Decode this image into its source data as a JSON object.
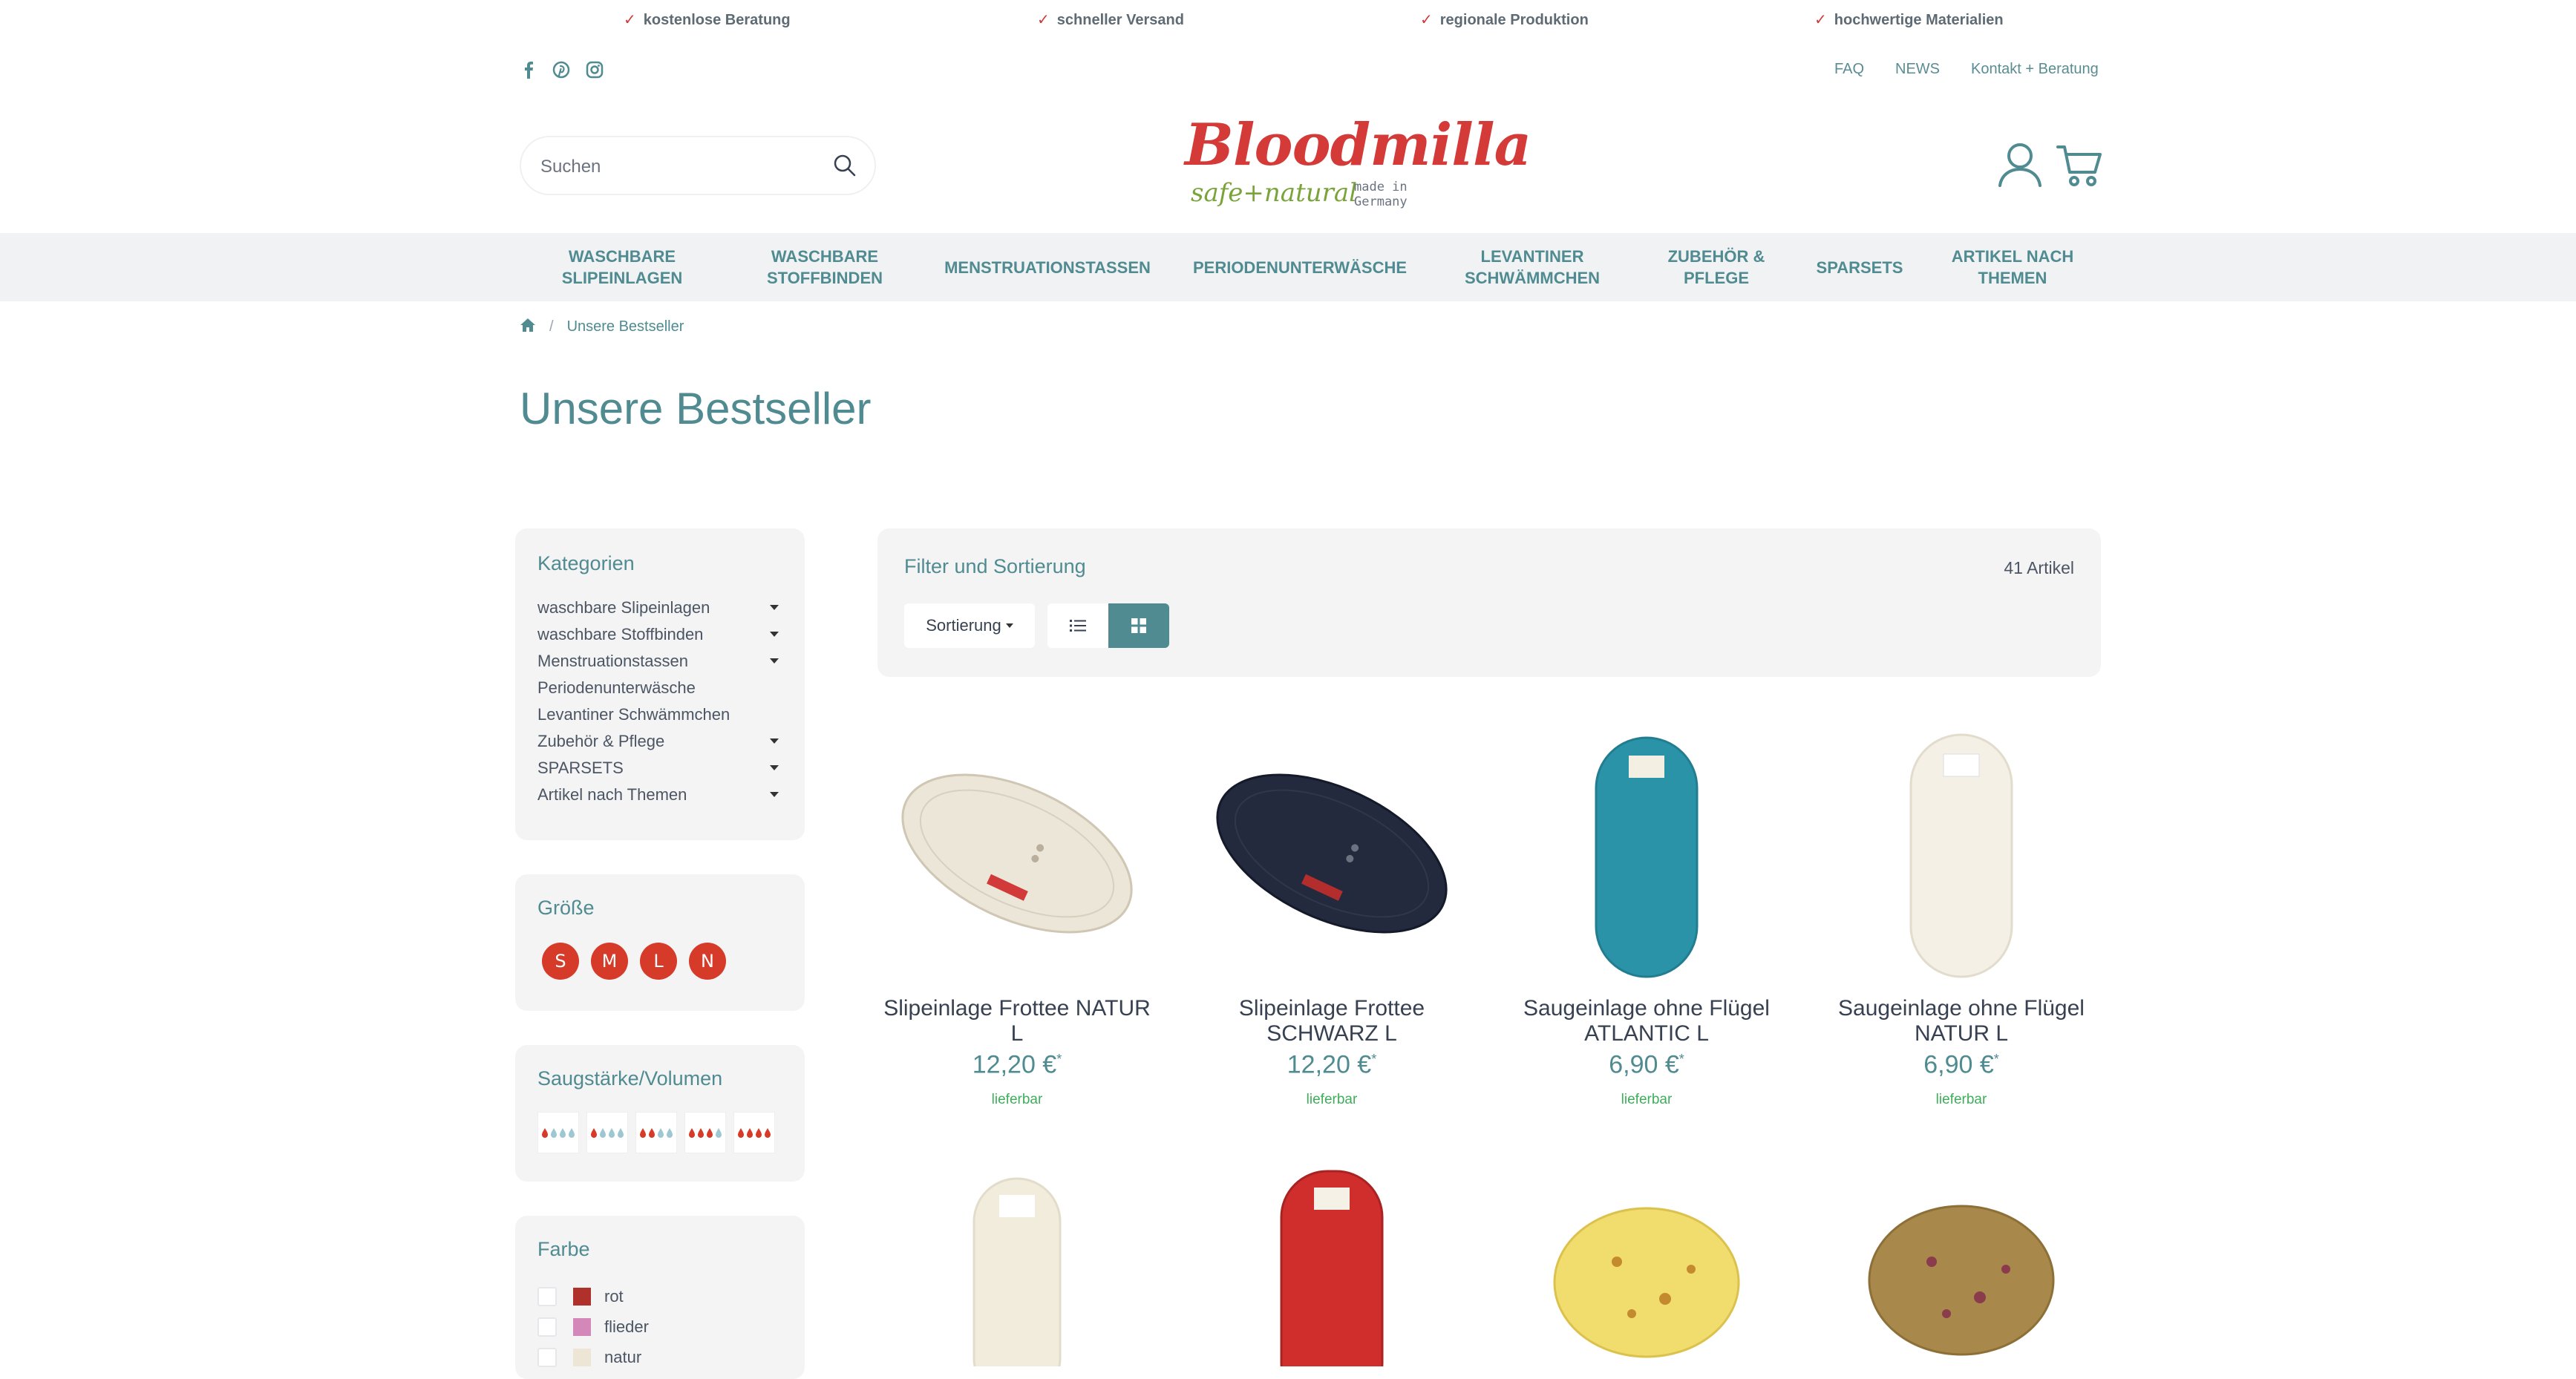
{
  "usp": [
    {
      "check": "✓",
      "text": "kostenlose Beratung"
    },
    {
      "check": "✓",
      "text": "schneller Versand"
    },
    {
      "check": "✓",
      "text": "regionale Produktion"
    },
    {
      "check": "✓",
      "text": "hochwertige Materialien"
    }
  ],
  "top_links": [
    "FAQ",
    "NEWS",
    "Kontakt + Beratung"
  ],
  "search": {
    "placeholder": "Suchen"
  },
  "logo": {
    "word": "Bloodmilla",
    "tagline": "safe+natural",
    "note_line1": "made in",
    "note_line2": "Germany"
  },
  "nav": [
    {
      "line1": "WASCHBARE",
      "line2": "SLIPEINLAGEN"
    },
    {
      "line1": "WASCHBARE",
      "line2": "STOFFBINDEN"
    },
    {
      "line1": "MENSTRUATIONSTASSEN",
      "line2": ""
    },
    {
      "line1": "PERIODENUNTERWÄSCHE",
      "line2": ""
    },
    {
      "line1": "LEVANTINER",
      "line2": "SCHWÄMMCHEN"
    },
    {
      "line1": "ZUBEHÖR &",
      "line2": "PFLEGE"
    },
    {
      "line1": "SPARSETS",
      "line2": ""
    },
    {
      "line1": "ARTIKEL NACH",
      "line2": "THEMEN"
    }
  ],
  "breadcrumb": {
    "separator": "/",
    "current": "Unsere Bestseller"
  },
  "page_title": "Unsere Bestseller",
  "sidebar": {
    "categories_title": "Kategorien",
    "categories": [
      "waschbare Slipeinlagen",
      "waschbare Stoffbinden",
      "Menstruationstassen",
      "Periodenunterwäsche",
      "Levantiner Schwämmchen",
      "Zubehör & Pflege",
      "SPARSETS",
      "Artikel nach Themen"
    ],
    "size_title": "Größe",
    "sizes": [
      "S",
      "M",
      "L",
      "N"
    ],
    "absorb_title": "Saugstärke/Volumen",
    "color_title": "Farbe",
    "colors": [
      {
        "label": "rot",
        "hex": "#b0302b"
      },
      {
        "label": "flieder",
        "hex": "#d487b9"
      },
      {
        "label": "natur",
        "hex": "#ede6d6"
      }
    ]
  },
  "filter": {
    "title": "Filter und Sortierung",
    "count": "41 Artikel",
    "sort_label": "Sortierung"
  },
  "products": [
    {
      "name": "Slipeinlage Frottee NATUR L",
      "price": "12,20 €",
      "star": "*",
      "stock": "lieferbar"
    },
    {
      "name": "Slipeinlage Frottee SCHWARZ L",
      "price": "12,20 €",
      "star": "*",
      "stock": "lieferbar"
    },
    {
      "name": "Saugeinlage ohne Flügel ATLANTIC L",
      "price": "6,90 €",
      "star": "*",
      "stock": "lieferbar"
    },
    {
      "name": "Saugeinlage ohne Flügel NATUR L",
      "price": "6,90 €",
      "star": "*",
      "stock": "lieferbar"
    }
  ],
  "colors": {
    "accent": "#4f8b91",
    "brand_red": "#d43a37",
    "stock_green": "#3fae5a",
    "panel_bg": "#f4f4f5"
  }
}
